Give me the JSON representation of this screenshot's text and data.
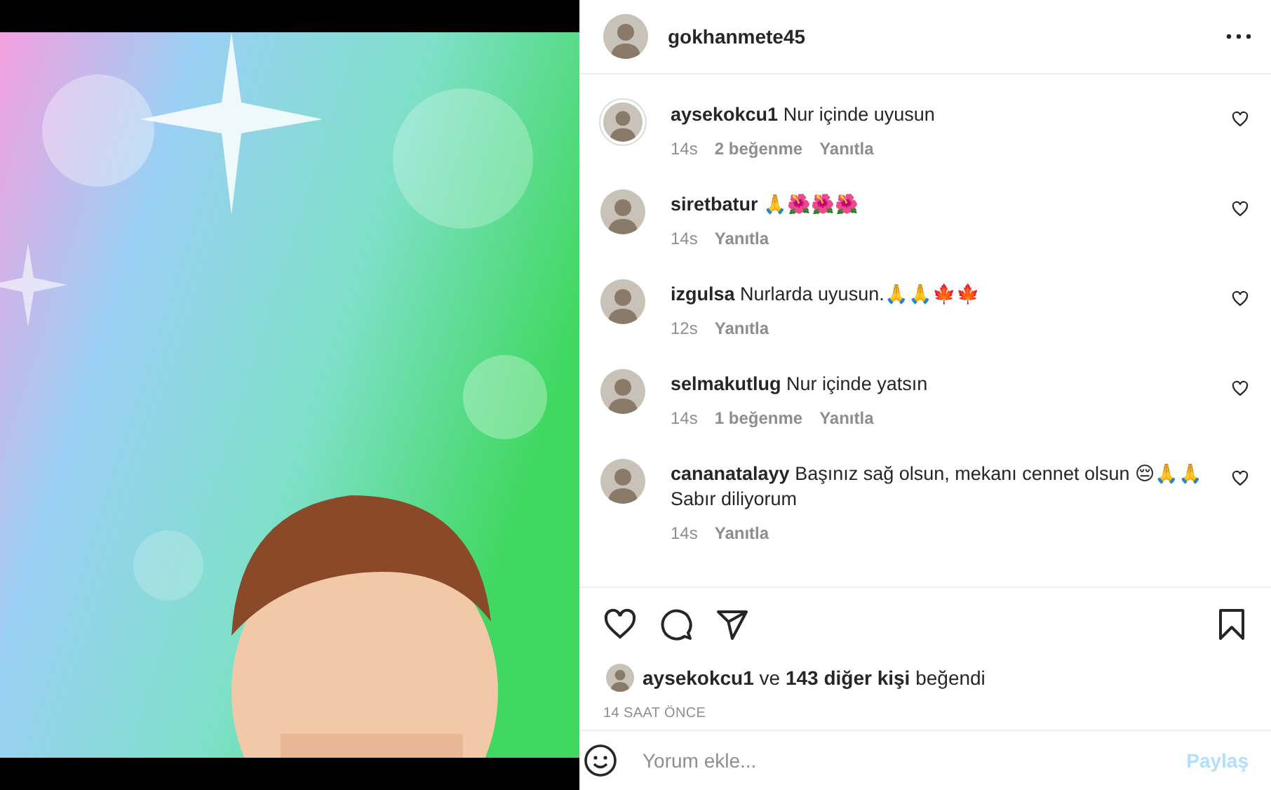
{
  "author": {
    "username": "gokhanmete45"
  },
  "comments": [
    {
      "username": "aysekokcu1",
      "text": "Nur içinde uyusun",
      "time": "14s",
      "likes": "2 beğenme",
      "reply": "Yanıtla",
      "ring": true
    },
    {
      "username": "siretbatur",
      "text": "🙏🌺🌺🌺",
      "time": "14s",
      "reply": "Yanıtla",
      "ring": false
    },
    {
      "username": "izgulsa",
      "text": "Nurlarda uyusun.🙏🙏🍁🍁",
      "time": "12s",
      "reply": "Yanıtla",
      "ring": false
    },
    {
      "username": "selmakutlug",
      "text": "Nur içinde yatsın",
      "time": "14s",
      "likes": "1 beğenme",
      "reply": "Yanıtla",
      "ring": false
    },
    {
      "username": "cananatalayy",
      "text": "Başınız sağ olsun, mekanı cennet olsun 😔🙏🙏Sabır diliyorum",
      "time": "14s",
      "reply": "Yanıtla",
      "ring": false
    }
  ],
  "likes_line": {
    "text": "**aysekokcu1** ve **143 diğer kişi** beğendi"
  },
  "timestamp": "14 SAAT ÖNCE",
  "comment_box": {
    "placeholder": "Yorum ekle...",
    "post_button": "Paylaş",
    "disabled": true
  }
}
